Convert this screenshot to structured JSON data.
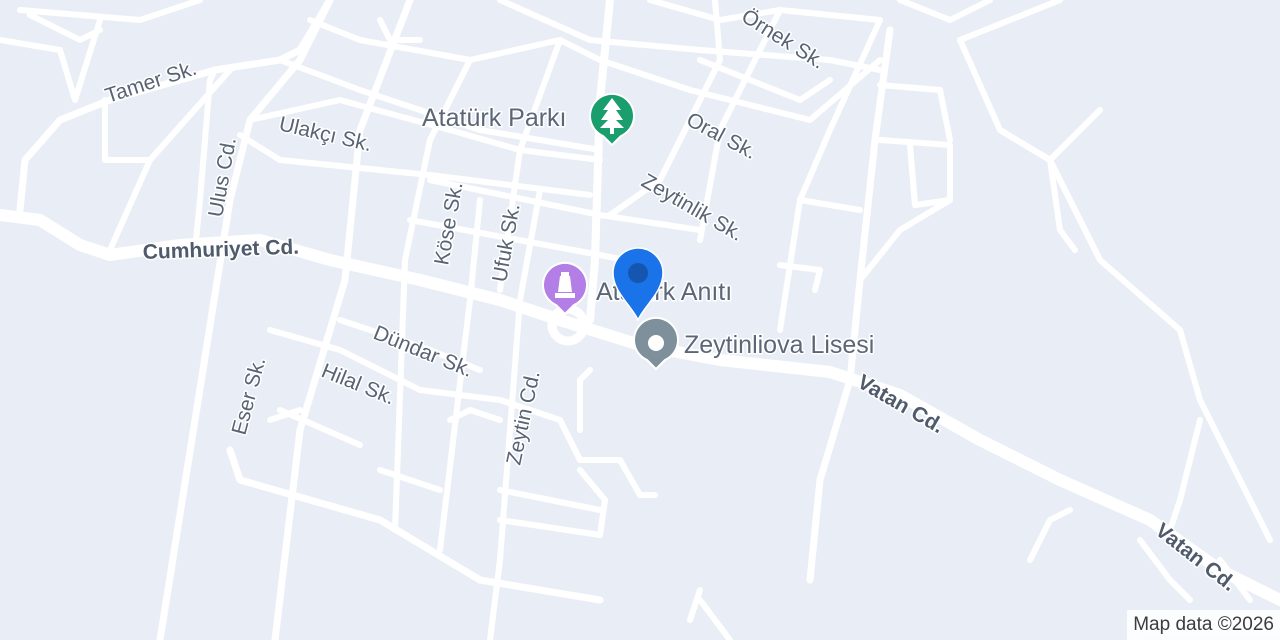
{
  "colors": {
    "background": "#e9eef6",
    "road": "#ffffff",
    "park_marker": "#1a9e6e",
    "monument_marker": "#b37fe6",
    "school_marker": "#7e909c",
    "location_pin": "#1a73e8"
  },
  "streets": {
    "tamer": "Tamer Sk.",
    "ulus": "Ulus Cd.",
    "ulakci": "Ulakçı Sk.",
    "cumhuriyet": "Cumhuriyet Cd.",
    "kose": "Köse Sk.",
    "ufuk": "Ufuk Sk.",
    "ornek": "Örnek Sk.",
    "oral": "Oral Sk.",
    "zeytinlik": "Zeytinlik Sk.",
    "dundar": "Dündar Sk.",
    "hilal": "Hilal Sk.",
    "eser": "Eser Sk.",
    "zeytin": "Zeytin Cd.",
    "vatan_1": "Vatan Cd.",
    "vatan_2": "Vatan Cd."
  },
  "pois": {
    "park": {
      "label": "Atatürk Parkı",
      "icon": "tree-icon"
    },
    "monument": {
      "label": "Atatürk Anıtı",
      "icon": "monument-icon"
    },
    "school": {
      "label": "Zeytinliova Lisesi",
      "icon": "place-dot-icon"
    }
  },
  "location_pin": {
    "icon": "location-pin-icon"
  },
  "attribution": "Map data ©2026"
}
